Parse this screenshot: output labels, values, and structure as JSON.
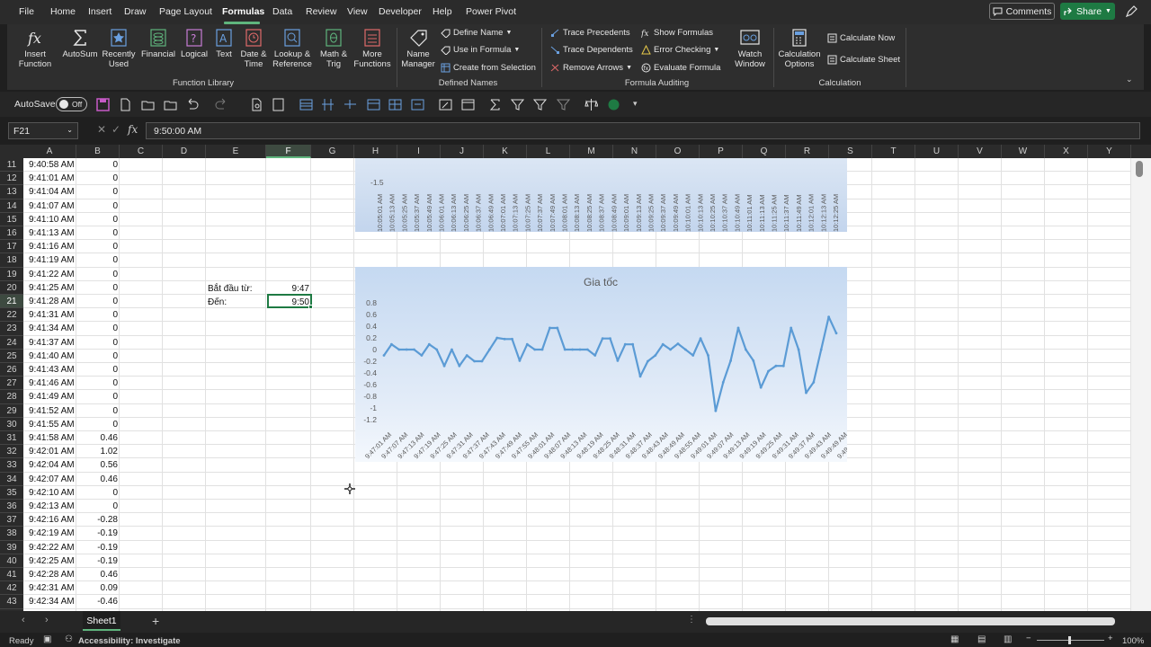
{
  "menu": {
    "items": [
      "File",
      "Home",
      "Insert",
      "Draw",
      "Page Layout",
      "Formulas",
      "Data",
      "Review",
      "View",
      "Developer",
      "Help",
      "Power Pivot"
    ],
    "active": "Formulas",
    "comments": "Comments",
    "share": "Share"
  },
  "ribbon": {
    "function_library": {
      "insert_function": "Insert Function",
      "autosum": "AutoSum",
      "recently_used": "Recently Used",
      "financial": "Financial",
      "logical": "Logical",
      "text": "Text",
      "date_time": "Date & Time",
      "lookup_reference": "Lookup & Reference",
      "math_trig": "Math & Trig",
      "more_functions": "More Functions",
      "label": "Function Library"
    },
    "defined_names": {
      "name_manager": "Name Manager",
      "define_name": "Define Name",
      "use_in_formula": "Use in Formula",
      "create_from_selection": "Create from Selection",
      "label": "Defined Names"
    },
    "formula_auditing": {
      "trace_precedents": "Trace Precedents",
      "trace_dependents": "Trace Dependents",
      "remove_arrows": "Remove Arrows",
      "show_formulas": "Show Formulas",
      "error_checking": "Error Checking",
      "evaluate_formula": "Evaluate Formula",
      "watch_window": "Watch Window",
      "label": "Formula Auditing"
    },
    "calculation": {
      "calculation_options": "Calculation Options",
      "calculate_now": "Calculate Now",
      "calculate_sheet": "Calculate Sheet",
      "label": "Calculation"
    }
  },
  "qat": {
    "autosave": "AutoSave",
    "toggle": "Off"
  },
  "formula_bar": {
    "name_box": "F21",
    "fx": "fx",
    "value": "9:50:00 AM"
  },
  "columns": [
    "A",
    "B",
    "C",
    "D",
    "E",
    "F",
    "G",
    "H",
    "I",
    "J",
    "K",
    "L",
    "M",
    "N",
    "O",
    "P",
    "Q",
    "R",
    "S",
    "T",
    "U",
    "V",
    "W",
    "X",
    "Y"
  ],
  "rows": [
    {
      "n": "11",
      "a": "9:40:58 AM",
      "b": "0"
    },
    {
      "n": "12",
      "a": "9:41:01 AM",
      "b": "0"
    },
    {
      "n": "13",
      "a": "9:41:04 AM",
      "b": "0"
    },
    {
      "n": "14",
      "a": "9:41:07 AM",
      "b": "0"
    },
    {
      "n": "15",
      "a": "9:41:10 AM",
      "b": "0"
    },
    {
      "n": "16",
      "a": "9:41:13 AM",
      "b": "0"
    },
    {
      "n": "17",
      "a": "9:41:16 AM",
      "b": "0"
    },
    {
      "n": "18",
      "a": "9:41:19 AM",
      "b": "0"
    },
    {
      "n": "19",
      "a": "9:41:22 AM",
      "b": "0"
    },
    {
      "n": "20",
      "a": "9:41:25 AM",
      "b": "0"
    },
    {
      "n": "21",
      "a": "9:41:28 AM",
      "b": "0"
    },
    {
      "n": "22",
      "a": "9:41:31 AM",
      "b": "0"
    },
    {
      "n": "23",
      "a": "9:41:34 AM",
      "b": "0"
    },
    {
      "n": "24",
      "a": "9:41:37 AM",
      "b": "0"
    },
    {
      "n": "25",
      "a": "9:41:40 AM",
      "b": "0"
    },
    {
      "n": "26",
      "a": "9:41:43 AM",
      "b": "0"
    },
    {
      "n": "27",
      "a": "9:41:46 AM",
      "b": "0"
    },
    {
      "n": "28",
      "a": "9:41:49 AM",
      "b": "0"
    },
    {
      "n": "29",
      "a": "9:41:52 AM",
      "b": "0"
    },
    {
      "n": "30",
      "a": "9:41:55 AM",
      "b": "0"
    },
    {
      "n": "31",
      "a": "9:41:58 AM",
      "b": "0.46"
    },
    {
      "n": "32",
      "a": "9:42:01 AM",
      "b": "1.02"
    },
    {
      "n": "33",
      "a": "9:42:04 AM",
      "b": "0.56"
    },
    {
      "n": "34",
      "a": "9:42:07 AM",
      "b": "0.46"
    },
    {
      "n": "35",
      "a": "9:42:10 AM",
      "b": "0"
    },
    {
      "n": "36",
      "a": "9:42:13 AM",
      "b": "0"
    },
    {
      "n": "37",
      "a": "9:42:16 AM",
      "b": "-0.28"
    },
    {
      "n": "38",
      "a": "9:42:19 AM",
      "b": "-0.19"
    },
    {
      "n": "39",
      "a": "9:42:22 AM",
      "b": "-0.19"
    },
    {
      "n": "40",
      "a": "9:42:25 AM",
      "b": "-0.19"
    },
    {
      "n": "41",
      "a": "9:42:28 AM",
      "b": "0.46"
    },
    {
      "n": "42",
      "a": "9:42:31 AM",
      "b": "0.09"
    },
    {
      "n": "43",
      "a": "9:42:34 AM",
      "b": "-0.46"
    }
  ],
  "inputs": {
    "from_label": "Bắt đầu từ:",
    "from_value": "9:47",
    "to_label": "Đến:",
    "to_value": "9:50"
  },
  "chart_top": {
    "tick_label": "-1.5",
    "x_labels": [
      "10:05:01 AM",
      "10:05:13 AM",
      "10:05:25 AM",
      "10:05:37 AM",
      "10:05:49 AM",
      "10:06:01 AM",
      "10:06:13 AM",
      "10:06:25 AM",
      "10:06:37 AM",
      "10:06:49 AM",
      "10:07:01 AM",
      "10:07:13 AM",
      "10:07:25 AM",
      "10:07:37 AM",
      "10:07:49 AM",
      "10:08:01 AM",
      "10:08:13 AM",
      "10:08:25 AM",
      "10:08:37 AM",
      "10:08:49 AM",
      "10:09:01 AM",
      "10:09:13 AM",
      "10:09:25 AM",
      "10:09:37 AM",
      "10:09:49 AM",
      "10:10:01 AM",
      "10:10:13 AM",
      "10:10:25 AM",
      "10:10:37 AM",
      "10:10:49 AM",
      "10:11:01 AM",
      "10:11:13 AM",
      "10:11:25 AM",
      "10:11:37 AM",
      "10:11:49 AM",
      "10:12:01 AM",
      "10:12:13 AM",
      "10:12:25 AM"
    ]
  },
  "chart_data": {
    "type": "line",
    "title": "Gia tốc",
    "ylim": [
      -1.2,
      0.8
    ],
    "yticks": [
      "0.8",
      "0.6",
      "0.4",
      "0.2",
      "0",
      "-0.2",
      "-0.4",
      "-0.6",
      "-0.8",
      "-1",
      "-1.2"
    ],
    "x_labels": [
      "9:47:01 AM",
      "9:47:07 AM",
      "9:47:13 AM",
      "9:47:19 AM",
      "9:47:25 AM",
      "9:47:31 AM",
      "9:47:37 AM",
      "9:47:43 AM",
      "9:47:49 AM",
      "9:47:55 AM",
      "9:48:01 AM",
      "9:48:07 AM",
      "9:48:13 AM",
      "9:48:19 AM",
      "9:48:25 AM",
      "9:48:31 AM",
      "9:48:37 AM",
      "9:48:43 AM",
      "9:48:49 AM",
      "9:48:55 AM",
      "9:49:01 AM",
      "9:49:07 AM",
      "9:49:13 AM",
      "9:49:19 AM",
      "9:49:25 AM",
      "9:49:31 AM",
      "9:49:37 AM",
      "9:49:43 AM",
      "9:49:49 AM",
      "9:49:55 AM"
    ],
    "values": [
      -0.1,
      0.09,
      0,
      0,
      0,
      -0.1,
      0.09,
      0,
      -0.28,
      0,
      -0.28,
      -0.1,
      -0.2,
      -0.2,
      0,
      0.2,
      0.18,
      0.18,
      -0.19,
      0.09,
      0,
      0,
      0.37,
      0.37,
      0,
      0,
      0,
      0,
      -0.1,
      0.19,
      0.19,
      -0.19,
      0.09,
      0.09,
      -0.46,
      -0.2,
      -0.1,
      0.09,
      0,
      0.1,
      0,
      -0.1,
      0.19,
      -0.1,
      -1.05,
      -0.56,
      -0.19,
      0.37,
      0,
      -0.19,
      -0.65,
      -0.37,
      -0.28,
      -0.28,
      0.37,
      0,
      -0.74,
      -0.56,
      0,
      0.56,
      0.28
    ],
    "line_color": "#5b9bd5",
    "grid": false
  },
  "sheets": {
    "active": "Sheet1"
  },
  "status": {
    "ready": "Ready",
    "accessibility": "Accessibility: Investigate",
    "zoom": "100%"
  }
}
